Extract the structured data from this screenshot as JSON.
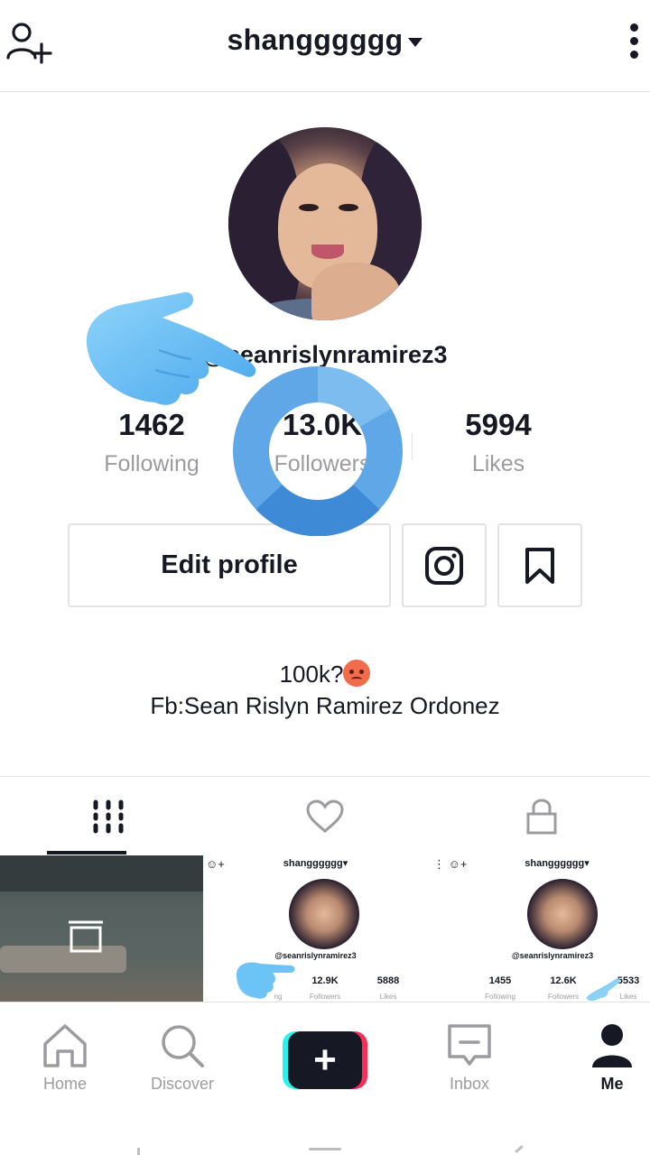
{
  "header": {
    "username": "shangggggg",
    "icons": [
      "add-user-icon",
      "chevron-down-icon",
      "more-vertical-icon"
    ]
  },
  "profile": {
    "handle": "@seanrislynramirez3",
    "stats": {
      "following": {
        "value": "1462",
        "label": "Following"
      },
      "followers": {
        "value": "13.0K",
        "label": "Followers"
      },
      "likes": {
        "value": "5994",
        "label": "Likes"
      }
    },
    "edit_label": "Edit profile",
    "bio_line1": "100k?",
    "bio_emoji": "angry-face-emoji",
    "bio_line2": "Fb:Sean Rislyn Ramirez Ordonez"
  },
  "tabs": [
    {
      "name": "videos",
      "icon": "grid-icon",
      "active": true
    },
    {
      "name": "liked",
      "icon": "heart-icon",
      "active": false
    },
    {
      "name": "private",
      "icon": "lock-icon",
      "active": false
    }
  ],
  "thumbnails": [
    {
      "type": "draft",
      "icon": "draft-icon"
    },
    {
      "type": "screenshot",
      "username": "shangggggg▾",
      "handle": "@seanrislynramirez3",
      "stats": [
        {
          "value": "",
          "label": "ng"
        },
        {
          "value": "12.9K",
          "label": "Followers"
        },
        {
          "value": "5888",
          "label": "Likes"
        }
      ]
    },
    {
      "type": "screenshot",
      "username": "shangggggg▾",
      "handle": "@seanrislynramirez3",
      "stats": [
        {
          "value": "1455",
          "label": "Following"
        },
        {
          "value": "12.6K",
          "label": "Followers"
        },
        {
          "value": "5533",
          "label": "Likes"
        }
      ]
    }
  ],
  "bottom_nav": {
    "home": "Home",
    "discover": "Discover",
    "create": "+",
    "inbox": "Inbox",
    "me": "Me"
  },
  "colors": {
    "text": "#161823",
    "muted": "#9c9ca0",
    "border": "#e3e3e4",
    "accent_cyan": "#25f4ee",
    "accent_red": "#fe2c55",
    "overlay_blue": "#4a9fe6"
  }
}
